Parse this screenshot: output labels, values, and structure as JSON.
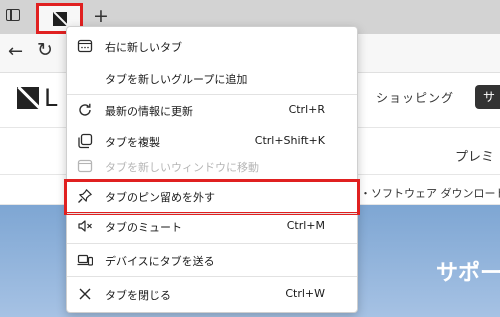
{
  "tabstrip": {
    "new_tab_symbol": "+"
  },
  "toolbar": {
    "back_symbol": "←",
    "reload_symbol": "↻"
  },
  "page": {
    "logo_letter": "L",
    "nav_shopping": "ショッピング",
    "nav_support": "サ",
    "premium": "プレミ",
    "software_link": "・ソフトウェア ダウンロード",
    "hero_title": "サポー"
  },
  "menu": {
    "items": [
      {
        "label": "右に新しいタブ",
        "icon": "new-tab-icon"
      },
      {
        "label": "タブを新しいグループに追加",
        "icon": ""
      },
      {
        "label": "最新の情報に更新",
        "shortcut": "Ctrl+R",
        "icon": "refresh-icon"
      },
      {
        "label": "タブを複製",
        "shortcut": "Ctrl+Shift+K",
        "icon": "duplicate-icon"
      },
      {
        "label": "タブを新しいウィンドウに移動",
        "icon": "window-icon",
        "disabled": true
      },
      {
        "label": "タブのピン留めを外す",
        "icon": "pin-icon",
        "highlighted": true
      },
      {
        "label": "タブのミュート",
        "shortcut": "Ctrl+M",
        "icon": "mute-icon"
      },
      {
        "label": "デバイスにタブを送る",
        "icon": "device-icon"
      },
      {
        "label": "タブを閉じる",
        "shortcut": "Ctrl+W",
        "icon": "close-icon"
      }
    ]
  },
  "colors": {
    "highlight": "#e02020",
    "hero": "#8fb2dc"
  }
}
